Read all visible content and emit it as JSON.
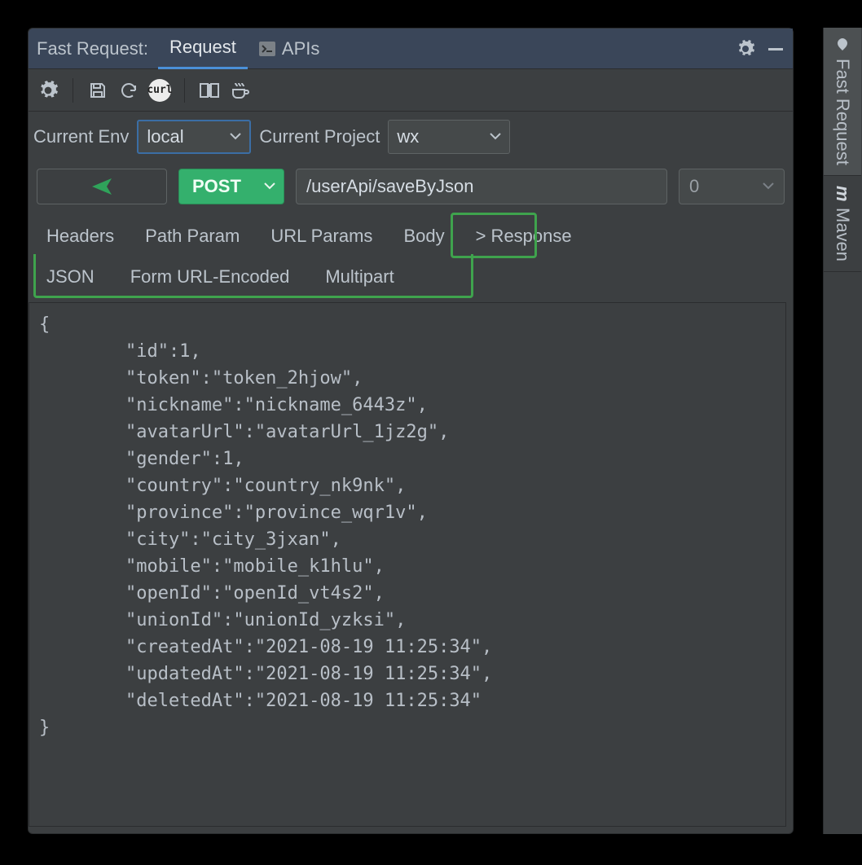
{
  "topbar": {
    "title": "Fast Request:",
    "tabs": [
      {
        "label": "Request",
        "active": true
      },
      {
        "label": "APIs",
        "active": false
      }
    ]
  },
  "toolbar": {
    "curl_label": "curl"
  },
  "env": {
    "label": "Current Env",
    "value": "local",
    "project_label": "Current Project",
    "project_value": "wx"
  },
  "request": {
    "method": "POST",
    "url": "/userApi/saveByJson",
    "timeout": "0"
  },
  "reqtabs": {
    "headers": "Headers",
    "path_param": "Path Param",
    "url_params": "URL Params",
    "body": "Body",
    "response": "> Response"
  },
  "subtabs": {
    "json": "JSON",
    "form": "Form URL-Encoded",
    "multipart": "Multipart"
  },
  "body_text": "{\n        \"id\":1,\n        \"token\":\"token_2hjow\",\n        \"nickname\":\"nickname_6443z\",\n        \"avatarUrl\":\"avatarUrl_1jz2g\",\n        \"gender\":1,\n        \"country\":\"country_nk9nk\",\n        \"province\":\"province_wqr1v\",\n        \"city\":\"city_3jxan\",\n        \"mobile\":\"mobile_k1hlu\",\n        \"openId\":\"openId_vt4s2\",\n        \"unionId\":\"unionId_yzksi\",\n        \"createdAt\":\"2021-08-19 11:25:34\",\n        \"updatedAt\":\"2021-08-19 11:25:34\",\n        \"deletedAt\":\"2021-08-19 11:25:34\"\n}",
  "rightbar": {
    "fast_request": "Fast Request",
    "maven": "Maven",
    "maven_m": "m"
  }
}
